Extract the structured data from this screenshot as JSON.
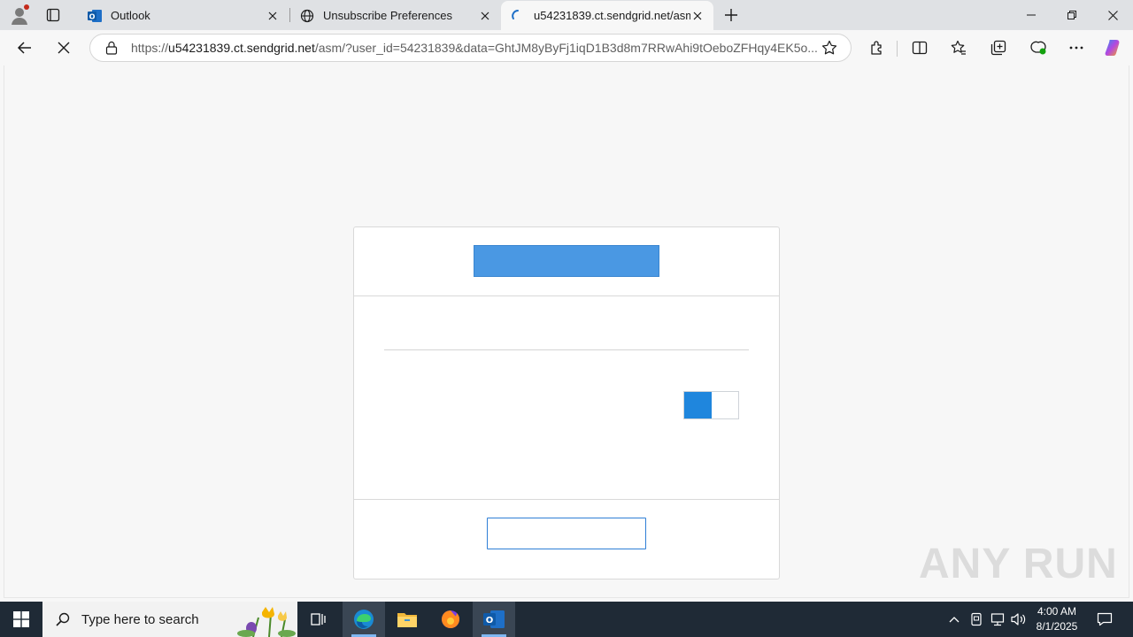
{
  "browser": {
    "tabs": [
      {
        "title": "Outlook",
        "icon": "outlook-icon"
      },
      {
        "title": "Unsubscribe Preferences",
        "icon": "globe-icon"
      },
      {
        "title": "u54231839.ct.sendgrid.net/asm/?",
        "icon": "loading-icon"
      }
    ],
    "url_domain": "u54231839.ct.sendgrid.net",
    "url_prefix": "https://",
    "url_rest": "/asm/?user_id=54231839&data=GhtJM8yByFj1iqD1B3d8m7RRwAhi9tOeboZFHqy4EK5o..."
  },
  "page": {
    "toggle_on": true
  },
  "watermark": "ANY RUN",
  "taskbar": {
    "search_placeholder": "Type here to search",
    "time": "4:00 AM",
    "date": "8/1/2025"
  },
  "colors": {
    "accent_blue": "#4a98e3",
    "toggle_blue": "#1f86dd",
    "button_border": "#2f7fd6",
    "taskbar": "#1f2a36"
  }
}
